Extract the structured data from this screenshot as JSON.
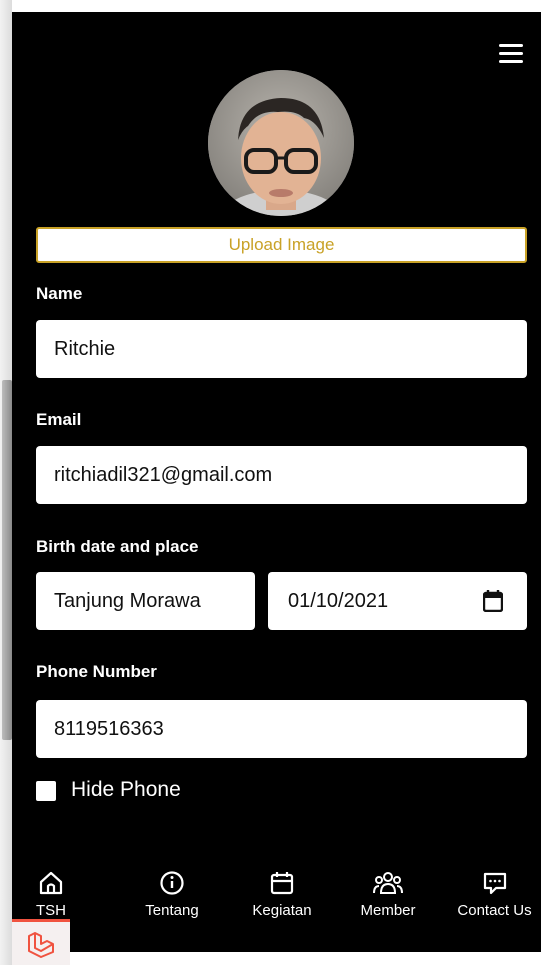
{
  "profile": {
    "upload_label": "Upload Image",
    "name_label": "Name",
    "name_value": "Ritchie",
    "email_label": "Email",
    "email_value": "ritchiadil321@gmail.com",
    "birth_label": "Birth date and place",
    "birth_place_value": "Tanjung Morawa",
    "birth_date_value": "01/10/2021",
    "phone_label": "Phone Number",
    "phone_value": "8119516363",
    "hide_phone_label": "Hide Phone",
    "hide_phone_checked": false
  },
  "nav": {
    "items": [
      {
        "label": "TSH",
        "icon": "home-icon"
      },
      {
        "label": "Tentang",
        "icon": "info-icon"
      },
      {
        "label": "Kegiatan",
        "icon": "calendar-icon"
      },
      {
        "label": "Member",
        "icon": "users-icon"
      },
      {
        "label": "Contact Us",
        "icon": "chat-icon"
      }
    ]
  },
  "colors": {
    "background": "#000000",
    "accent": "#c9a227",
    "laravel": "#f05340"
  }
}
